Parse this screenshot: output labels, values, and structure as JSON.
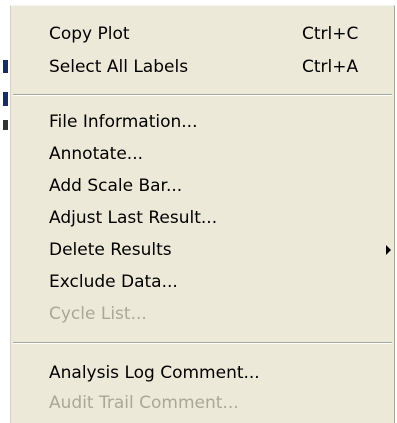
{
  "menu": {
    "groups": [
      {
        "items": [
          {
            "label": "Copy Plot",
            "shortcut": "Ctrl+C",
            "enabled": true
          },
          {
            "label": "Select All Labels",
            "shortcut": "Ctrl+A",
            "enabled": true
          }
        ]
      },
      {
        "items": [
          {
            "label": "File Information...",
            "enabled": true
          },
          {
            "label": "Annotate...",
            "enabled": true
          },
          {
            "label": "Add Scale Bar...",
            "enabled": true
          },
          {
            "label": "Adjust Last Result...",
            "enabled": true
          },
          {
            "label": "Delete Results",
            "enabled": true,
            "submenu": true,
            "arrow_icon": "submenu-arrow-right-icon"
          },
          {
            "label": "Exclude Data...",
            "enabled": true
          },
          {
            "label": "Cycle List...",
            "enabled": false
          }
        ]
      },
      {
        "items": [
          {
            "label": "Analysis Log Comment...",
            "enabled": true
          },
          {
            "label": "Audit Trail Comment...",
            "enabled": false
          }
        ]
      }
    ]
  },
  "colors": {
    "menu_background": "#ece9d8",
    "text": "#000000",
    "disabled_text": "#a9a799",
    "separator_dark": "#aca899",
    "separator_light": "#ffffff"
  }
}
